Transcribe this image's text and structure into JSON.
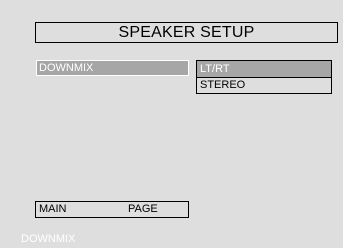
{
  "header": {
    "title": "SPEAKER SETUP"
  },
  "menu": {
    "items": [
      {
        "label": "DOWNMIX",
        "selected": true
      }
    ]
  },
  "submenu": {
    "options": [
      {
        "label": "LT/RT",
        "selected": true
      },
      {
        "label": "STEREO",
        "selected": false
      }
    ]
  },
  "footer": {
    "main_label": "MAIN",
    "page_label": "PAGE"
  },
  "status": {
    "text": "DOWNMIX"
  },
  "colors": {
    "background": "#dedede",
    "highlight": "#a6a6a6",
    "highlight_text": "#ffffff",
    "border": "#000000"
  }
}
